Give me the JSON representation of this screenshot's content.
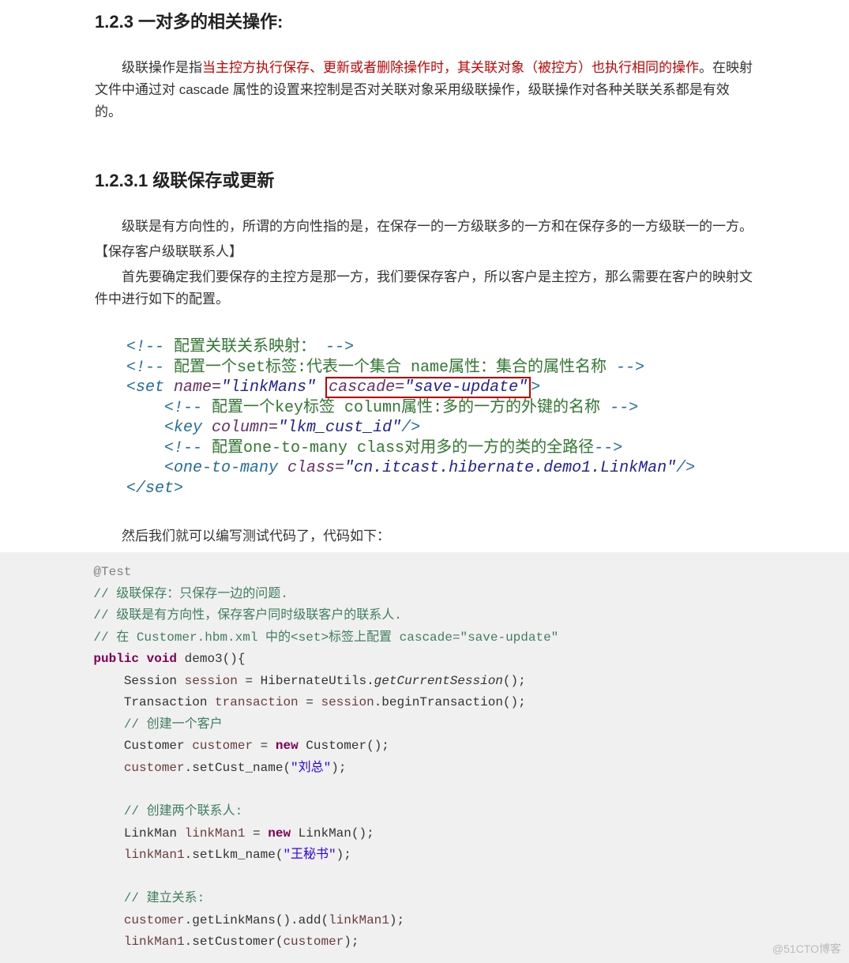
{
  "heading1": "1.2.3  一对多的相关操作:",
  "para1_a": "级联操作是指",
  "para1_red": "当主控方执行保存、更新或者删除操作时，其关联对象（被控方）也执行相同的操作",
  "para1_b": "。在映射文件中通过对 cascade 属性的设置来控制是否对关联对象采用级联操作，级联操作对各种关联关系都是有效的。",
  "heading2": "1.2.3.1 级联保存或更新",
  "para2": "级联是有方向性的，所谓的方向性指的是，在保存一的一方级联多的一方和在保存多的一方级联一的一方。",
  "bracket_line": "【保存客户级联联系人】",
  "para3": "首先要确定我们要保存的主控方是那一方，我们要保存客户，所以客户是主控方，那么需要在客户的映射文件中进行如下的配置。",
  "xml": {
    "c1a": "<!-- ",
    "c1b": "配置关联关系映射：",
    "c1c": " -->",
    "c2a": "<!-- ",
    "c2b": "配置一个set标签:代表一个集合 name属性：集合的属性名称",
    "c2c": " -->",
    "set_open": "<set",
    "name_attr": " name=",
    "name_val": "\"linkMans\"",
    "casc_attr": "cascade=",
    "casc_val": "\"save-update\"",
    "close_tag": ">",
    "c3a": "<!-- ",
    "c3b": "配置一个key标签 column属性:多的一方的外键的名称",
    "c3c": " -->",
    "key_open": "<key",
    "col_attr": " column=",
    "col_val": "\"lkm_cust_id\"",
    "self_close": "/>",
    "c4a": "<!-- ",
    "c4b": "配置one-to-many class对用多的一方的类的全路径",
    "c4c": "-->",
    "otm_open": "<one-to-many",
    "class_attr": " class=",
    "class_val": "\"cn.itcast.hibernate.demo1.LinkMan\"",
    "set_close": "</set>"
  },
  "para4": "然后我们就可以编写测试代码了，代码如下：",
  "code": {
    "l1_anno": "@Test",
    "l2": "// 级联保存：只保存一边的问题.",
    "l3": "// 级联是有方向性，保存客户同时级联客户的联系人.",
    "l4": "// 在 Customer.hbm.xml 中的<set>标签上配置 cascade=\"save-update\"",
    "l5_public": "public",
    "l5_void": "void",
    "l5_rest": " demo3(){",
    "l6_a": "Session ",
    "l6_var": "session",
    "l6_b": " = HibernateUtils.",
    "l6_c": "getCurrentSession",
    "l6_d": "();",
    "l7_a": "Transaction ",
    "l7_var": "transaction",
    "l7_b": " = ",
    "l7_var2": "session",
    "l7_c": ".beginTransaction();",
    "l8": "// 创建一个客户",
    "l9_a": "Customer ",
    "l9_var": "customer",
    "l9_b": " = ",
    "l9_new": "new",
    "l9_c": " Customer();",
    "l10_var": "customer",
    "l10_a": ".setCust_name(",
    "l10_str": "\"刘总\"",
    "l10_b": ");",
    "l12": "// 创建两个联系人:",
    "l13_a": "LinkMan ",
    "l13_var": "linkMan1",
    "l13_b": " = ",
    "l13_new": "new",
    "l13_c": " LinkMan();",
    "l14_var": "linkMan1",
    "l14_a": ".setLkm_name(",
    "l14_str": "\"王秘书\"",
    "l14_b": ");",
    "l16": "// 建立关系:",
    "l17_var": "customer",
    "l17_a": ".getLinkMans().add(",
    "l17_var2": "linkMan1",
    "l17_b": ");",
    "l18_var": "linkMan1",
    "l18_a": ".setCustomer(",
    "l18_var2": "customer",
    "l18_b": ");"
  },
  "watermark": "@51CTO博客"
}
